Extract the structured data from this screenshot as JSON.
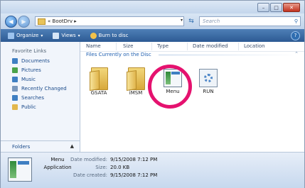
{
  "address": {
    "chevron": "«",
    "path": "BootDrv",
    "arrow": "▸"
  },
  "search": {
    "placeholder": "Search"
  },
  "toolbar": {
    "organize": "Organize",
    "views": "Views",
    "burn": "Burn to disc"
  },
  "nav": {
    "heading": "Favorite Links",
    "items": [
      {
        "label": "Documents",
        "color": "#3f7fc2"
      },
      {
        "label": "Pictures",
        "color": "#4aa34a"
      },
      {
        "label": "Music",
        "color": "#3f7fc2"
      },
      {
        "label": "Recently Changed",
        "color": "#7a98bd"
      },
      {
        "label": "Searches",
        "color": "#3f7fc2"
      },
      {
        "label": "Public",
        "color": "#e2b74c"
      }
    ],
    "folders": "Folders"
  },
  "columns": [
    "Name",
    "Size",
    "Type",
    "Date modified",
    "Location"
  ],
  "group": "Files Currently on the Disc",
  "files": [
    {
      "name": "GSATA"
    },
    {
      "name": "iMSM"
    },
    {
      "name": "Menu"
    },
    {
      "name": "RUN"
    }
  ],
  "details": {
    "name": "Menu",
    "type": "Application",
    "modified_label": "Date modified:",
    "modified": "9/15/2008 7:12 PM",
    "size_label": "Size:",
    "size": "20.0 KB",
    "created_label": "Date created:",
    "created": "9/15/2008 7:12 PM"
  },
  "colors": {
    "highlight_circle": "#e5126f",
    "toolbar": "#2c5a93"
  }
}
